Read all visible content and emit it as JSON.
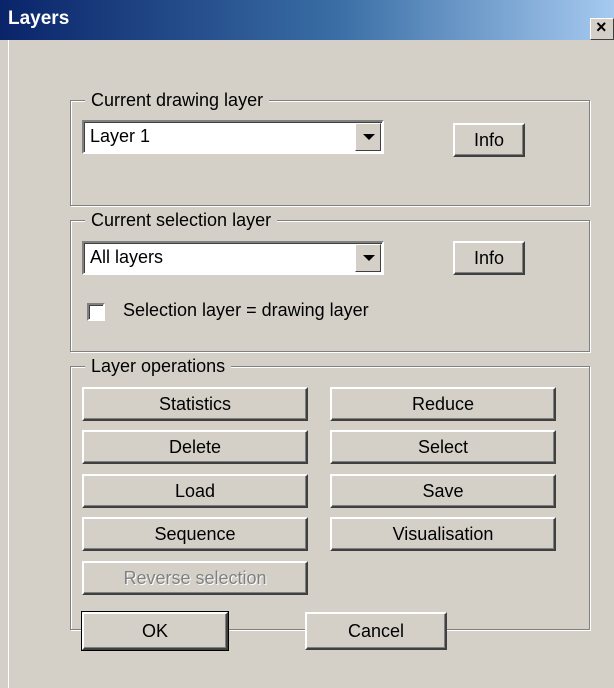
{
  "window": {
    "title": "Layers",
    "close_label": "×"
  },
  "drawing_layer": {
    "group_label": "Current drawing layer",
    "selected": "Layer 1",
    "info_label": "Info"
  },
  "selection_layer": {
    "group_label": "Current selection layer",
    "selected": "All layers",
    "info_label": "Info",
    "checkbox_label": "Selection layer = drawing layer",
    "checkbox_checked": false
  },
  "operations": {
    "group_label": "Layer operations",
    "statistics": "Statistics",
    "reduce": "Reduce",
    "delete": "Delete",
    "select": "Select",
    "load": "Load",
    "save": "Save",
    "sequence": "Sequence",
    "visualisation": "Visualisation",
    "reverse_selection": "Reverse selection"
  },
  "footer": {
    "ok": "OK",
    "cancel": "Cancel"
  }
}
